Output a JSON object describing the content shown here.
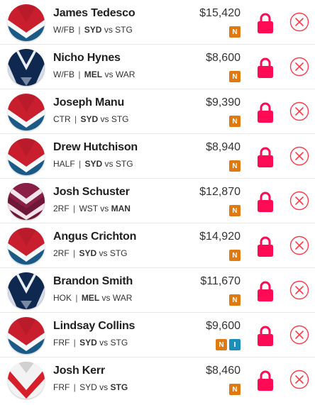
{
  "players": [
    {
      "name": "James Tedesco",
      "position": "W/FB",
      "team": "SYD",
      "vs_text": "vs",
      "opponent": "STG",
      "bold_side": "team",
      "price": "$15,420",
      "badges": [
        "N"
      ],
      "jersey": "roosters"
    },
    {
      "name": "Nicho Hynes",
      "position": "W/FB",
      "team": "MEL",
      "vs_text": "vs",
      "opponent": "WAR",
      "bold_side": "team",
      "price": "$8,600",
      "badges": [
        "N"
      ],
      "jersey": "storm"
    },
    {
      "name": "Joseph Manu",
      "position": "CTR",
      "team": "SYD",
      "vs_text": "vs",
      "opponent": "STG",
      "bold_side": "team",
      "price": "$9,390",
      "badges": [
        "N"
      ],
      "jersey": "roosters"
    },
    {
      "name": "Drew Hutchison",
      "position": "HALF",
      "team": "SYD",
      "vs_text": "vs",
      "opponent": "STG",
      "bold_side": "team",
      "price": "$8,940",
      "badges": [
        "N"
      ],
      "jersey": "roosters"
    },
    {
      "name": "Josh Schuster",
      "position": "2RF",
      "team": "WST",
      "vs_text": "vs",
      "opponent": "MAN",
      "bold_side": "opponent",
      "price": "$12,870",
      "badges": [
        "N"
      ],
      "jersey": "manly"
    },
    {
      "name": "Angus Crichton",
      "position": "2RF",
      "team": "SYD",
      "vs_text": "vs",
      "opponent": "STG",
      "bold_side": "team",
      "price": "$14,920",
      "badges": [
        "N"
      ],
      "jersey": "roosters"
    },
    {
      "name": "Brandon Smith",
      "position": "HOK",
      "team": "MEL",
      "vs_text": "vs",
      "opponent": "WAR",
      "bold_side": "team",
      "price": "$11,670",
      "badges": [
        "N"
      ],
      "jersey": "storm"
    },
    {
      "name": "Lindsay Collins",
      "position": "FRF",
      "team": "SYD",
      "vs_text": "vs",
      "opponent": "STG",
      "bold_side": "team",
      "price": "$9,600",
      "badges": [
        "N",
        "I"
      ],
      "jersey": "roosters"
    },
    {
      "name": "Josh Kerr",
      "position": "FRF",
      "team": "SYD",
      "vs_text": "vs",
      "opponent": "STG",
      "bold_side": "opponent",
      "price": "$8,460",
      "badges": [
        "N"
      ],
      "jersey": "dragons"
    }
  ],
  "colors": {
    "lock": "#ff0a54",
    "remove": "#ff3b4a",
    "badge_n": "#e07a10",
    "badge_i": "#1a8fb8"
  },
  "icons": {
    "lock": "lock-icon",
    "remove": "close-circle-icon",
    "jersey": "team-jersey-icon"
  }
}
